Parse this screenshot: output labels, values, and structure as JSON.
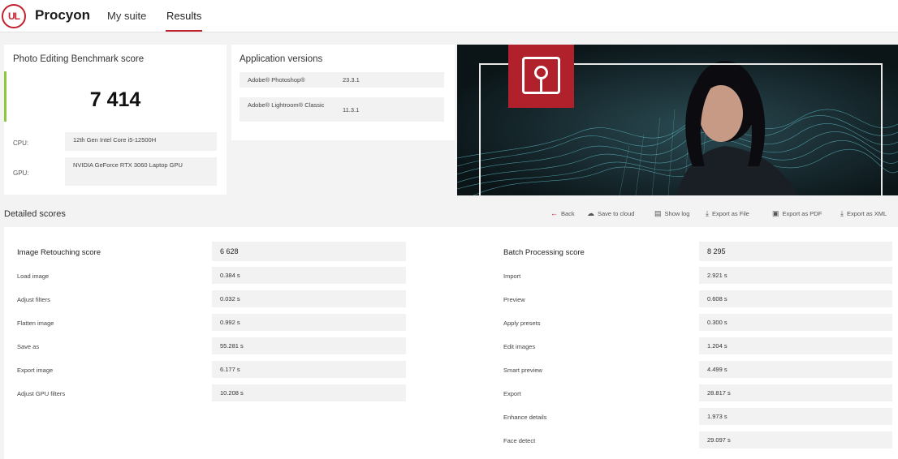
{
  "header": {
    "logo_text": "UL",
    "app_name": "Procyon",
    "tabs": [
      {
        "label": "My suite"
      },
      {
        "label": "Results"
      }
    ],
    "accent_color": "#c2222e"
  },
  "score_card": {
    "title": "Photo Editing Benchmark score",
    "score": "7 414",
    "cpu_label": "CPU:",
    "cpu_value": "12th Gen Intel Core i5-12500H",
    "gpu_label": "GPU:",
    "gpu_value": "NVIDIA GeForce RTX 3060 Laptop GPU",
    "accent_color": "#8dc63f"
  },
  "app_versions": {
    "title": "Application versions",
    "apps": [
      {
        "name": "Adobe® Photoshop®",
        "version": "23.3.1"
      },
      {
        "name": "Adobe® Lightroom® Classic",
        "version": "11.3.1"
      }
    ]
  },
  "detailed": {
    "title": "Detailed scores",
    "toolbar": {
      "back": "Back",
      "save_cloud": "Save to cloud",
      "show_log": "Show log",
      "export_file": "Export as File",
      "export_pdf": "Export as PDF",
      "export_xml": "Export as XML"
    },
    "image_retouching": {
      "header_label": "Image Retouching score",
      "header_value": "6 628",
      "rows": [
        {
          "label": "Load image",
          "value": "0.384 s"
        },
        {
          "label": "Adjust filters",
          "value": "0.032 s"
        },
        {
          "label": "Flatten image",
          "value": "0.992 s"
        },
        {
          "label": "Save as",
          "value": "55.281 s"
        },
        {
          "label": "Export image",
          "value": "6.177 s"
        },
        {
          "label": "Adjust GPU filters",
          "value": "10.208 s"
        }
      ]
    },
    "batch_processing": {
      "header_label": "Batch Processing score",
      "header_value": "8 295",
      "rows": [
        {
          "label": "Import",
          "value": "2.921 s"
        },
        {
          "label": "Preview",
          "value": "0.608 s"
        },
        {
          "label": "Apply presets",
          "value": "0.300 s"
        },
        {
          "label": "Edit images",
          "value": "1.204 s"
        },
        {
          "label": "Smart preview",
          "value": "4.499 s"
        },
        {
          "label": "Export",
          "value": "28.817 s"
        },
        {
          "label": "Enhance details",
          "value": "1.973 s"
        },
        {
          "label": "Face detect",
          "value": "29.097 s"
        }
      ]
    }
  }
}
